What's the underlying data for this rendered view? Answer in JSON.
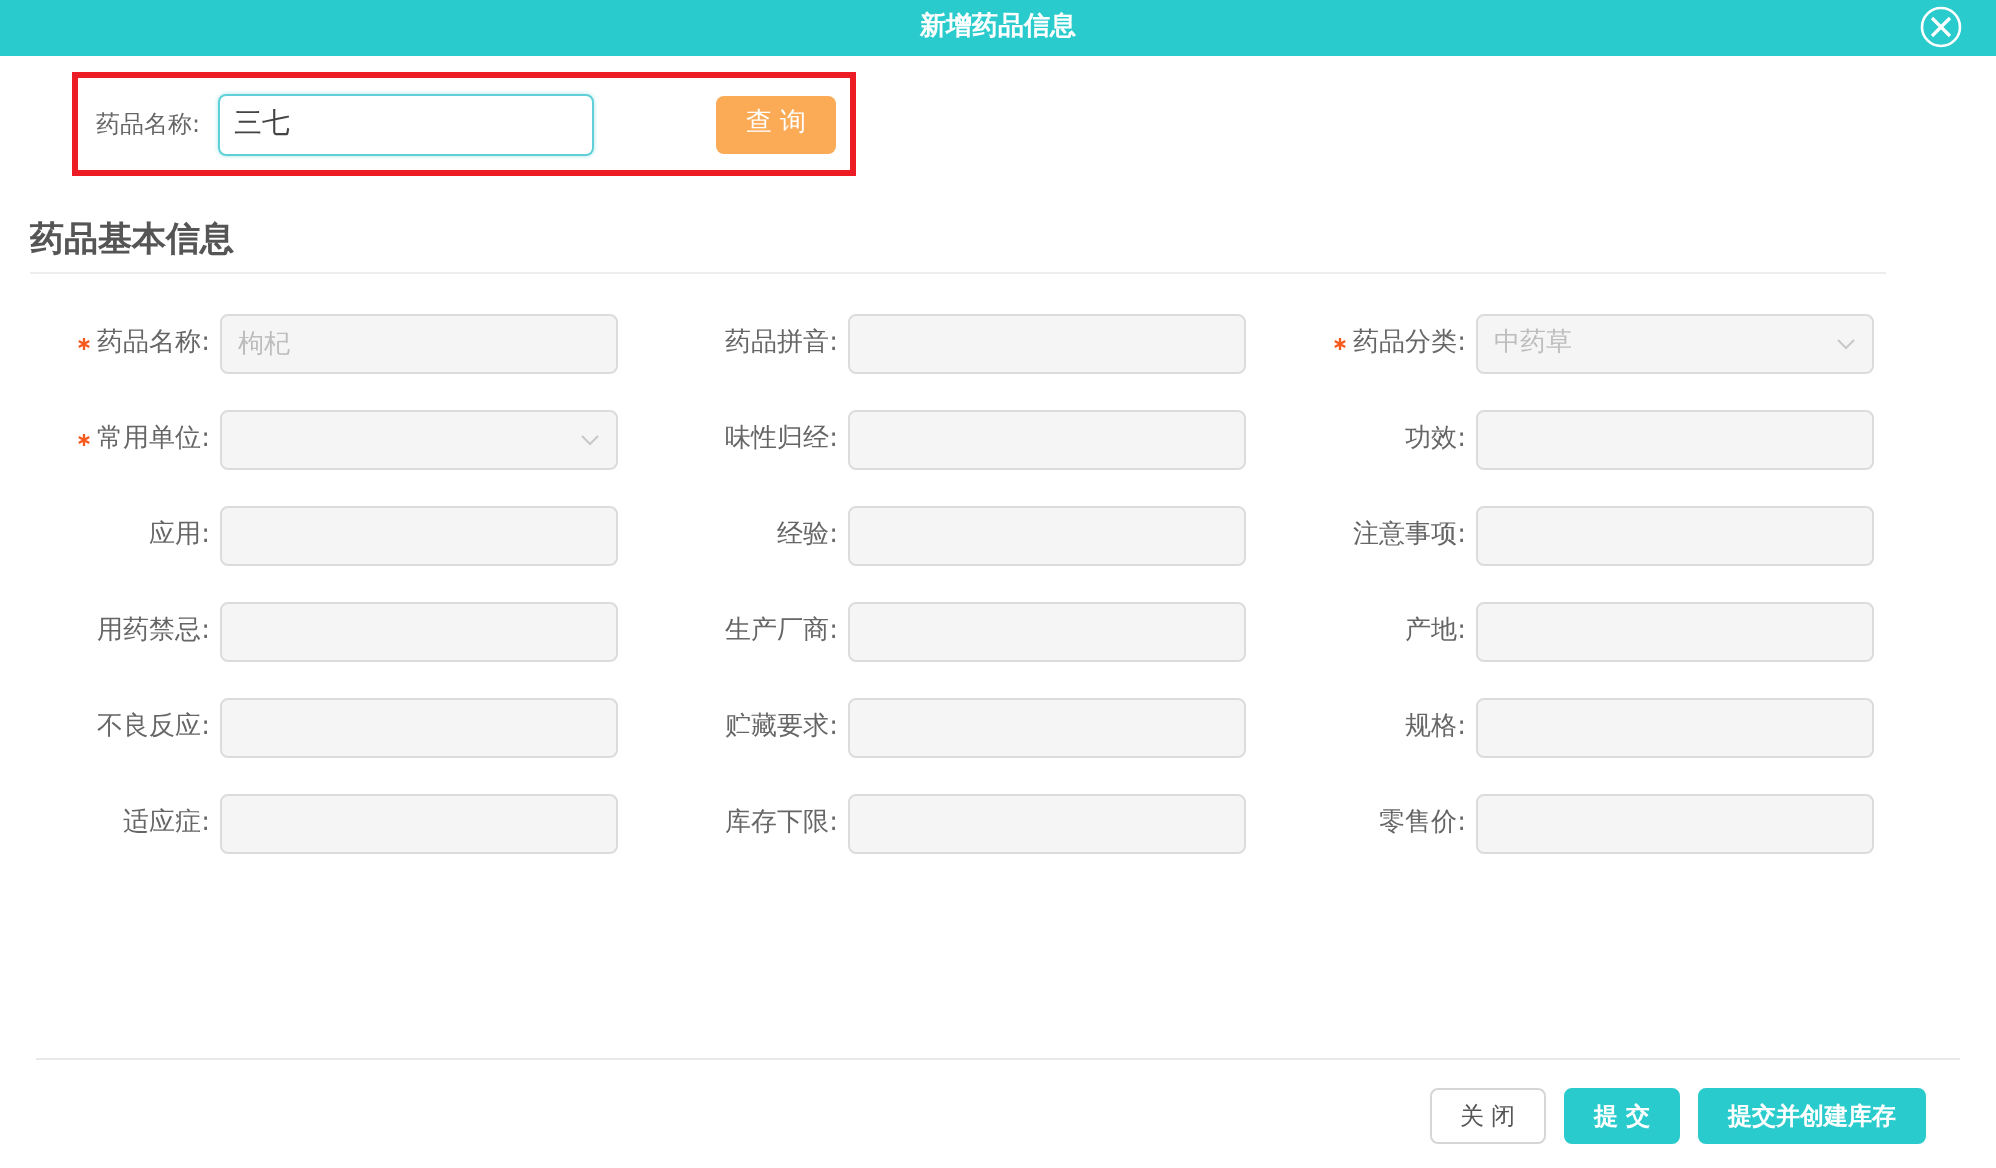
{
  "dialog": {
    "title": "新增药品信息"
  },
  "search": {
    "label": "药品名称:",
    "value": "三七",
    "button": "查 询",
    "highlighted": true
  },
  "section_title": "药品基本信息",
  "fields": [
    {
      "label": "药品名称:",
      "kind": "text",
      "required": true,
      "disabled": true,
      "value": "枸杞"
    },
    {
      "label": "药品拼音:",
      "kind": "text",
      "required": false,
      "disabled": true
    },
    {
      "label": "药品分类:",
      "kind": "select",
      "required": true,
      "disabled": true,
      "value": "中药草"
    },
    {
      "label": "常用单位:",
      "kind": "select",
      "required": true,
      "disabled": true
    },
    {
      "label": "味性归经:",
      "kind": "text",
      "required": false,
      "disabled": true
    },
    {
      "label": "功效:",
      "kind": "text",
      "required": false,
      "disabled": true
    },
    {
      "label": "应用:",
      "kind": "text",
      "required": false,
      "disabled": true
    },
    {
      "label": "经验:",
      "kind": "text",
      "required": false,
      "disabled": true
    },
    {
      "label": "注意事项:",
      "kind": "text",
      "required": false,
      "disabled": true
    },
    {
      "label": "用药禁忌:",
      "kind": "text",
      "required": false,
      "disabled": true
    },
    {
      "label": "生产厂商:",
      "kind": "text",
      "required": false,
      "disabled": true
    },
    {
      "label": "产地:",
      "kind": "text",
      "required": false,
      "disabled": true
    },
    {
      "label": "不良反应:",
      "kind": "text",
      "required": false,
      "disabled": true
    },
    {
      "label": "贮藏要求:",
      "kind": "text",
      "required": false,
      "disabled": true
    },
    {
      "label": "规格:",
      "kind": "text",
      "required": false,
      "disabled": true
    },
    {
      "label": "适应症:",
      "kind": "text",
      "required": false,
      "disabled": true
    },
    {
      "label": "库存下限:",
      "kind": "text",
      "required": false,
      "disabled": true
    },
    {
      "label": "零售价:",
      "kind": "text",
      "required": false,
      "disabled": true
    }
  ],
  "buttons": [
    {
      "label": "关 闭",
      "kind": "secondary"
    },
    {
      "label": "提 交",
      "kind": "primary"
    },
    {
      "label": "提交并创建库存",
      "kind": "primary"
    }
  ]
}
